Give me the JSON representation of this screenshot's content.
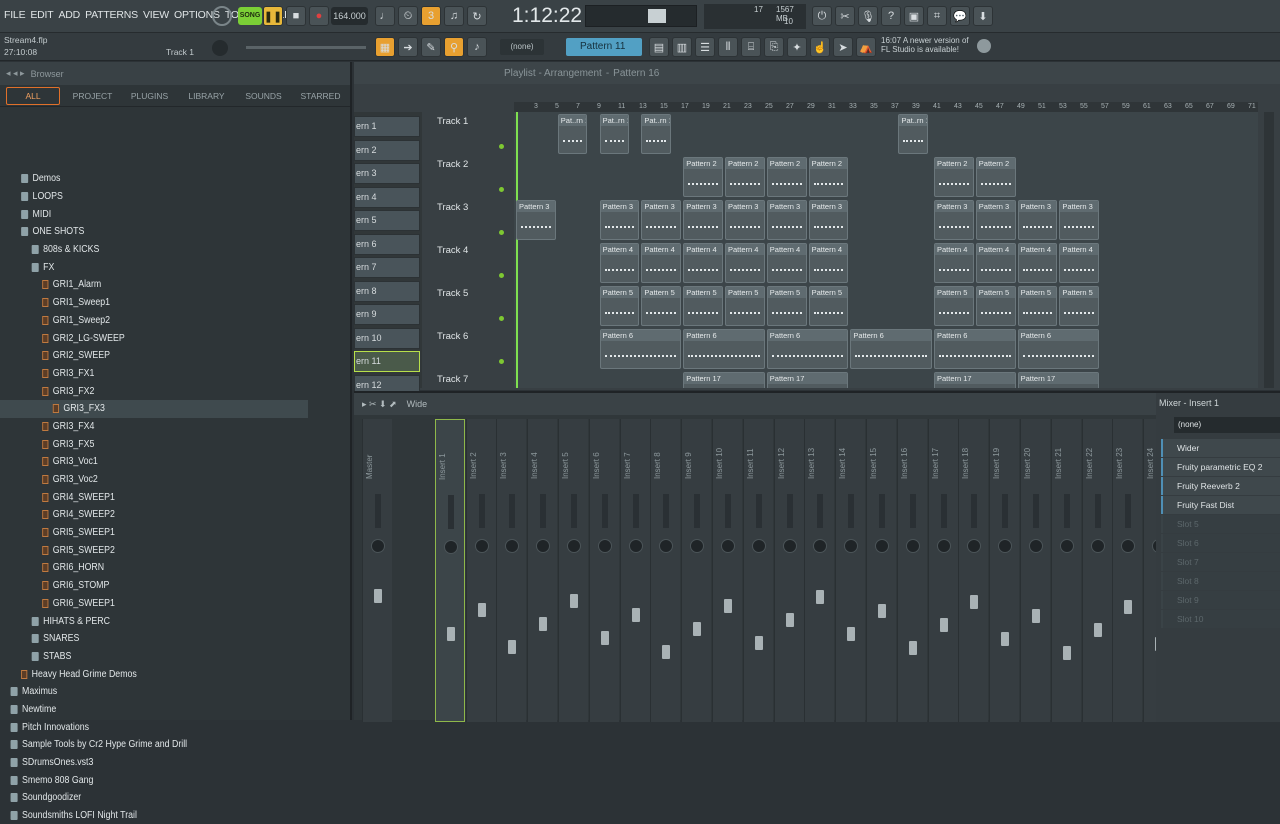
{
  "menu": [
    "FILE",
    "EDIT",
    "ADD",
    "PATTERNS",
    "VIEW",
    "OPTIONS",
    "TOOLS",
    "HELP"
  ],
  "transport": {
    "mode": "SONG",
    "time": "1:12:22",
    "tempo": "164.000",
    "cpu": "17",
    "ram": "1567 MB",
    "poly": "10"
  },
  "project": {
    "file": "Stream4.flp",
    "time": "27:10:08",
    "track": "Track 1"
  },
  "pattern_selector": {
    "current": "Pattern 11",
    "none": "(none)"
  },
  "notification": {
    "time": "16:07",
    "text": "A newer version of FL Studio is available!"
  },
  "browser": {
    "title": "Browser",
    "tabs": [
      "ALL",
      "PROJECT",
      "PLUGINS",
      "LIBRARY",
      "SOUNDS",
      "STARRED"
    ],
    "items": [
      {
        "label": "Demos",
        "type": "folder",
        "indent": 2
      },
      {
        "label": "LOOPS",
        "type": "folder",
        "indent": 2
      },
      {
        "label": "MIDI",
        "type": "folder",
        "indent": 2
      },
      {
        "label": "ONE SHOTS",
        "type": "folder",
        "indent": 2
      },
      {
        "label": "808s & KICKS",
        "type": "folder",
        "indent": 3
      },
      {
        "label": "FX",
        "type": "folder",
        "indent": 3
      },
      {
        "label": "GRI1_Alarm",
        "type": "file",
        "indent": 4
      },
      {
        "label": "GRI1_Sweep1",
        "type": "file",
        "indent": 4
      },
      {
        "label": "GRI1_Sweep2",
        "type": "file",
        "indent": 4
      },
      {
        "label": "GRI2_LG-SWEEP",
        "type": "file",
        "indent": 4
      },
      {
        "label": "GRI2_SWEEP",
        "type": "file",
        "indent": 4
      },
      {
        "label": "GRI3_FX1",
        "type": "file",
        "indent": 4
      },
      {
        "label": "GRI3_FX2",
        "type": "file",
        "indent": 4
      },
      {
        "label": "GRI3_FX3",
        "type": "file",
        "indent": 5,
        "selected": true
      },
      {
        "label": "GRI3_FX4",
        "type": "file",
        "indent": 4
      },
      {
        "label": "GRI3_FX5",
        "type": "file",
        "indent": 4
      },
      {
        "label": "GRI3_Voc1",
        "type": "file",
        "indent": 4
      },
      {
        "label": "GRI3_Voc2",
        "type": "file",
        "indent": 4
      },
      {
        "label": "GRI4_SWEEP1",
        "type": "file",
        "indent": 4
      },
      {
        "label": "GRI4_SWEEP2",
        "type": "file",
        "indent": 4
      },
      {
        "label": "GRI5_SWEEP1",
        "type": "file",
        "indent": 4
      },
      {
        "label": "GRI5_SWEEP2",
        "type": "file",
        "indent": 4
      },
      {
        "label": "GRI6_HORN",
        "type": "file",
        "indent": 4
      },
      {
        "label": "GRI6_STOMP",
        "type": "file",
        "indent": 4
      },
      {
        "label": "GRI6_SWEEP1",
        "type": "file",
        "indent": 4
      },
      {
        "label": "HIHATS & PERC",
        "type": "folder",
        "indent": 3
      },
      {
        "label": "SNARES",
        "type": "folder",
        "indent": 3
      },
      {
        "label": "STABS",
        "type": "folder",
        "indent": 3
      },
      {
        "label": "Heavy Head Grime Demos",
        "type": "file",
        "indent": 2
      },
      {
        "label": "Maximus",
        "type": "folder",
        "indent": 1
      },
      {
        "label": "Newtime",
        "type": "folder",
        "indent": 1
      },
      {
        "label": "Pitch Innovations",
        "type": "folder",
        "indent": 1
      },
      {
        "label": "Sample Tools by Cr2 Hype Grime and Drill",
        "type": "folder",
        "indent": 1
      },
      {
        "label": "SDrumsOnes.vst3",
        "type": "folder",
        "indent": 1
      },
      {
        "label": "Smemo 808 Gang",
        "type": "folder",
        "indent": 1
      },
      {
        "label": "Soundgoodizer",
        "type": "folder",
        "indent": 1
      },
      {
        "label": "Soundsmiths LOFI Night Trail",
        "type": "folder",
        "indent": 1
      }
    ]
  },
  "playlist": {
    "title": "Playlist - Arrangement",
    "pattern": "Pattern 16",
    "ruler": [
      "3",
      "5",
      "7",
      "9",
      "11",
      "13",
      "15",
      "17",
      "19",
      "21",
      "23",
      "25",
      "27",
      "29",
      "31",
      "33",
      "35",
      "37",
      "39",
      "41",
      "43",
      "45",
      "47",
      "49",
      "51",
      "53",
      "55",
      "57",
      "59",
      "61",
      "63",
      "65",
      "67",
      "69",
      "71"
    ],
    "pattern_list": [
      "ern 1",
      "ern 2",
      "ern 3",
      "ern 4",
      "ern 5",
      "ern 6",
      "ern 7",
      "ern 8",
      "ern 9",
      "ern 10",
      "ern 11",
      "ern 12"
    ],
    "tracks": [
      "Track 1",
      "Track 2",
      "Track 3",
      "Track 4",
      "Track 5",
      "Track 6",
      "Track 7"
    ],
    "clips": [
      {
        "track": 0,
        "label": "Pat..rn 1",
        "starts": [
          2,
          4,
          6
        ],
        "len": 1.5,
        "extra": [
          18.3
        ]
      },
      {
        "track": 1,
        "label": "Pattern 2",
        "starts": [
          8,
          10,
          12,
          14
        ],
        "len": 2,
        "extra": [
          20,
          22
        ]
      },
      {
        "track": 2,
        "label": "Pattern 3",
        "starts": [
          0,
          4,
          6,
          8,
          10,
          12,
          14,
          20,
          22,
          24,
          26
        ],
        "len": 2
      },
      {
        "track": 3,
        "label": "Pattern 4",
        "starts": [
          4,
          6,
          8,
          10,
          12,
          14,
          20,
          22,
          24,
          26
        ],
        "len": 2
      },
      {
        "track": 4,
        "label": "Pattern 5",
        "starts": [
          4,
          6,
          8,
          10,
          12,
          14,
          20,
          22,
          24,
          26
        ],
        "len": 2
      },
      {
        "track": 5,
        "label": "Pattern 6",
        "starts": [
          4,
          8,
          12,
          16,
          20,
          24
        ],
        "len": 4
      },
      {
        "track": 6,
        "label": "Pattern 17",
        "starts": [
          8,
          12,
          20,
          24
        ],
        "len": 4
      }
    ]
  },
  "mixer": {
    "title": "Wide",
    "insert_title": "Mixer - Insert 1",
    "none": "(none)",
    "strips": [
      "Master",
      "Insert 1",
      "Insert 2",
      "Insert 3",
      "Insert 4",
      "Insert 5",
      "Insert 6",
      "Insert 7",
      "Insert 8",
      "Insert 9",
      "Insert 10",
      "Insert 11",
      "Insert 12",
      "Insert 13",
      "Insert 14",
      "Insert 15",
      "Insert 16",
      "Insert 17",
      "Insert 18",
      "Insert 19",
      "Insert 20",
      "Insert 21",
      "Insert 22",
      "Insert 23",
      "Insert 24"
    ],
    "fx_slots": [
      "Wider",
      "Fruity parametric EQ 2",
      "Fruity Reeverb 2",
      "Fruity Fast Dist",
      "Slot 5",
      "Slot 6",
      "Slot 7",
      "Slot 8",
      "Slot 9",
      "Slot 10"
    ]
  }
}
